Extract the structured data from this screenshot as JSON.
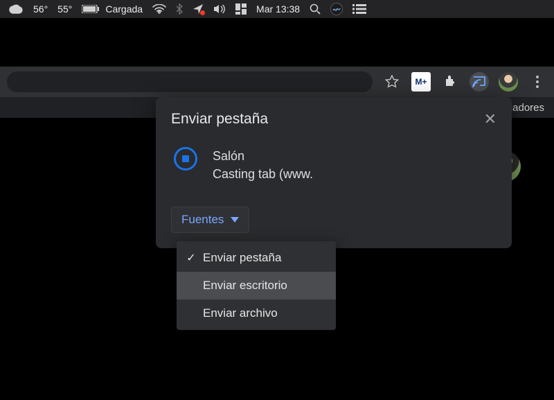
{
  "menubar": {
    "temp1": "56°",
    "temp2": "55°",
    "battery_label": "Cargada",
    "clock": "Mar 13:38"
  },
  "bookmarks": {
    "overflow_label": "arcadores"
  },
  "cast": {
    "title": "Enviar pestaña",
    "device_name": "Salón",
    "device_status": "Casting tab (www.",
    "sources_label": "Fuentes"
  },
  "sources_menu": {
    "items": [
      {
        "label": "Enviar pestaña",
        "checked": true
      },
      {
        "label": "Enviar escritorio",
        "checked": false,
        "hover": true
      },
      {
        "label": "Enviar archivo",
        "checked": false
      }
    ]
  }
}
